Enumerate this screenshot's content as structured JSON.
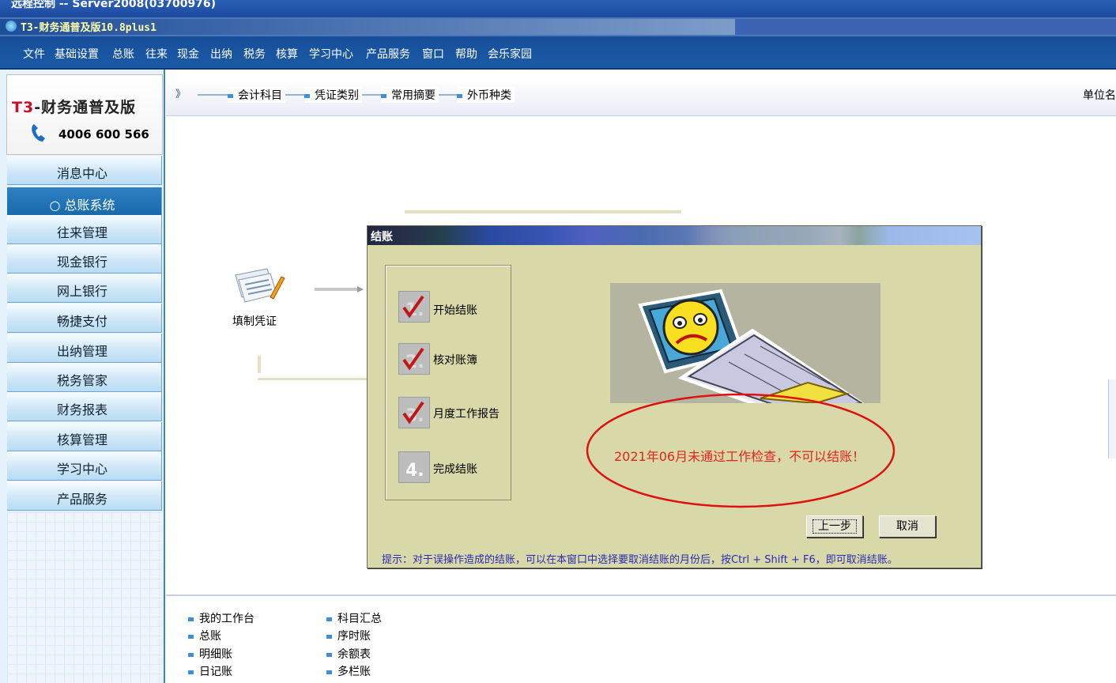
{
  "remote_title": "远程控制 -- Server2008(03700976)",
  "app_title": "T3-财务通普及版10.8plus1",
  "menu": [
    "文件",
    "基础设置",
    "总账",
    "往来",
    "现金",
    "出纳",
    "税务",
    "核算",
    "学习中心",
    "产品服务",
    "窗口",
    "帮助",
    "会乐家园"
  ],
  "brand": {
    "title_prefix": "T3",
    "title_rest": "-财务通普及版",
    "phone": "4006 600 566"
  },
  "nav": [
    {
      "label": "消息中心",
      "active": false
    },
    {
      "label": "○ 总账系统",
      "active": true
    },
    {
      "label": "往来管理",
      "active": false
    },
    {
      "label": "现金银行",
      "active": false
    },
    {
      "label": "网上银行",
      "active": false
    },
    {
      "label": "畅捷支付",
      "active": false
    },
    {
      "label": "出纳管理",
      "active": false
    },
    {
      "label": "税务管家",
      "active": false
    },
    {
      "label": "财务报表",
      "active": false
    },
    {
      "label": "核算管理",
      "active": false
    },
    {
      "label": "学习中心",
      "active": false
    },
    {
      "label": "产品服务",
      "active": false
    }
  ],
  "toolbar": {
    "arrow": "》",
    "items": [
      "会计科目",
      "凭证类别",
      "常用摘要",
      "外币种类"
    ],
    "unit_label": "单位名"
  },
  "flow": {
    "voucher_label": "填制凭证"
  },
  "bottom_links": {
    "col1": [
      "我的工作台",
      "总账",
      "明细账",
      "日记账"
    ],
    "col2": [
      "科目汇总",
      "序时账",
      "余额表",
      "多栏账"
    ]
  },
  "dialog": {
    "title": "结账",
    "steps": [
      {
        "num": "1.",
        "label": "开始结账",
        "done": true
      },
      {
        "num": "2.",
        "label": "核对账簿",
        "done": true
      },
      {
        "num": "3.",
        "label": "月度工作报告",
        "done": true
      },
      {
        "num": "4.",
        "label": "完成结账",
        "done": false
      }
    ],
    "message": "2021年06月未通过工作检查，不可以结账！",
    "prev_button": "上一步",
    "cancel_button": "取消",
    "hint": "提示：对于误操作造成的结账，可以在本窗口中选择要取消结账的月份后，按Ctrl + Shift + F6，即可取消结账。"
  },
  "colors": {
    "menubar": "#1b5aa6",
    "dialog_bg": "#d8d8a8",
    "message_red": "#e0251c",
    "hint_blue": "#2a2ab8"
  }
}
